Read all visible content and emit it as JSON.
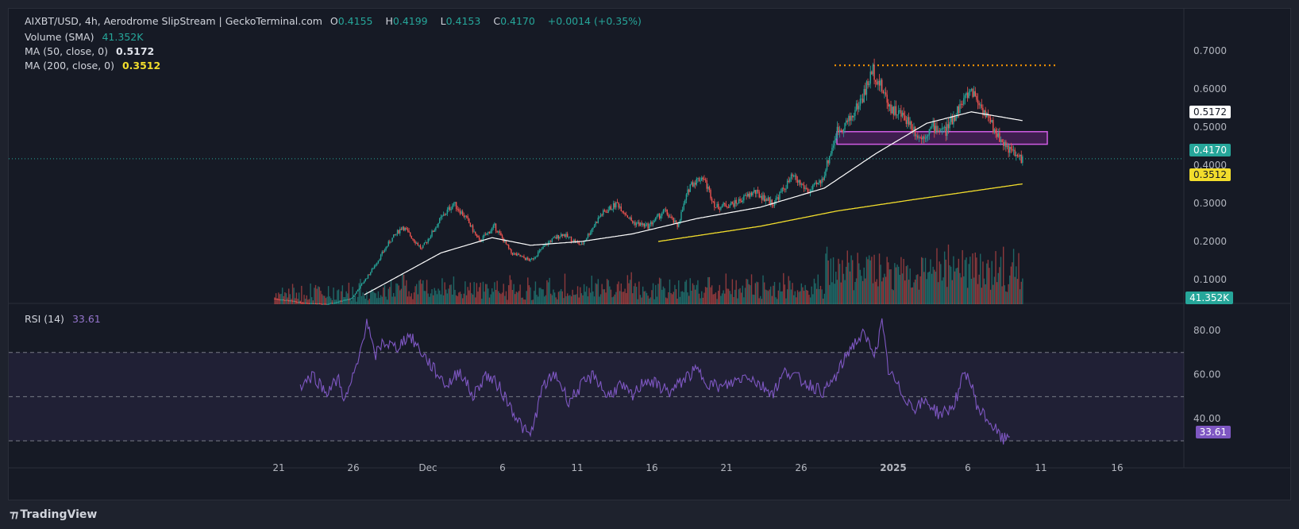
{
  "header": {
    "symbol_line": "AIXBT/USD, 4h, Aerodrome SlipStream | GeckoTerminal.com",
    "o_label": "O",
    "o_value": "0.4155",
    "h_label": "H",
    "h_value": "0.4199",
    "l_label": "L",
    "l_value": "0.4153",
    "c_label": "C",
    "c_value": "0.4170",
    "change": "+0.0014 (+0.35%)"
  },
  "indicators": {
    "volume_label": "Volume (SMA)",
    "volume_value": "41.352K",
    "ma50_label": "MA (50, close, 0)",
    "ma50_value": "0.5172",
    "ma200_label": "MA (200, close, 0)",
    "ma200_value": "0.3512",
    "rsi_label": "RSI (14)",
    "rsi_value": "33.61"
  },
  "badges": {
    "ma50": "0.5172",
    "price": "0.4170",
    "ma200": "0.3512",
    "volume": "41.352K",
    "rsi": "33.61"
  },
  "branding": {
    "logo_text": "TradingView"
  },
  "colors": {
    "up": "#26a69a",
    "down": "#ef5350",
    "ma50": "#ffffff",
    "ma200": "#f2dd2c",
    "rsi": "#7e57c2",
    "resistance": "#ff9800",
    "zone": "#9c27b0"
  },
  "chart_data": [
    {
      "type": "candlestick",
      "title": "AIXBT/USD 4h",
      "x_ticks": [
        "21",
        "26",
        "Dec",
        "6",
        "11",
        "16",
        "21",
        "26",
        "2025",
        "6",
        "11",
        "16"
      ],
      "y_ticks": [
        "0.7000",
        "0.6000",
        "0.5000",
        "0.4000",
        "0.3000",
        "0.2000",
        "0.1000"
      ],
      "ylim": [
        0.0,
        0.7
      ],
      "price_path": [
        [
          0,
          0.05
        ],
        [
          20,
          0.04
        ],
        [
          40,
          0.035
        ],
        [
          60,
          0.05
        ],
        [
          75,
          0.12
        ],
        [
          90,
          0.2
        ],
        [
          100,
          0.24
        ],
        [
          115,
          0.18
        ],
        [
          130,
          0.26
        ],
        [
          140,
          0.3
        ],
        [
          150,
          0.26
        ],
        [
          160,
          0.2
        ],
        [
          172,
          0.24
        ],
        [
          185,
          0.17
        ],
        [
          200,
          0.15
        ],
        [
          215,
          0.2
        ],
        [
          225,
          0.22
        ],
        [
          240,
          0.19
        ],
        [
          255,
          0.27
        ],
        [
          268,
          0.3
        ],
        [
          280,
          0.25
        ],
        [
          292,
          0.24
        ],
        [
          305,
          0.28
        ],
        [
          315,
          0.24
        ],
        [
          325,
          0.35
        ],
        [
          335,
          0.37
        ],
        [
          345,
          0.29
        ],
        [
          360,
          0.3
        ],
        [
          375,
          0.33
        ],
        [
          390,
          0.3
        ],
        [
          405,
          0.37
        ],
        [
          418,
          0.33
        ],
        [
          428,
          0.36
        ],
        [
          440,
          0.49
        ],
        [
          450,
          0.52
        ],
        [
          460,
          0.58
        ],
        [
          468,
          0.65
        ],
        [
          475,
          0.6
        ],
        [
          482,
          0.55
        ],
        [
          495,
          0.52
        ],
        [
          505,
          0.47
        ],
        [
          515,
          0.5
        ],
        [
          525,
          0.49
        ],
        [
          535,
          0.55
        ],
        [
          545,
          0.6
        ],
        [
          555,
          0.54
        ],
        [
          565,
          0.48
        ],
        [
          575,
          0.44
        ],
        [
          582,
          0.42
        ],
        [
          585,
          0.417
        ]
      ],
      "ma50": [
        [
          70,
          0.06
        ],
        [
          130,
          0.17
        ],
        [
          170,
          0.21
        ],
        [
          200,
          0.19
        ],
        [
          240,
          0.2
        ],
        [
          280,
          0.22
        ],
        [
          330,
          0.26
        ],
        [
          380,
          0.29
        ],
        [
          430,
          0.34
        ],
        [
          470,
          0.43
        ],
        [
          510,
          0.51
        ],
        [
          545,
          0.54
        ],
        [
          585,
          0.517
        ]
      ],
      "ma200": [
        [
          300,
          0.2
        ],
        [
          380,
          0.24
        ],
        [
          440,
          0.28
        ],
        [
          500,
          0.31
        ],
        [
          585,
          0.351
        ]
      ],
      "resistance": 0.662,
      "zone": [
        0.455,
        0.488
      ],
      "current_price": 0.417
    },
    {
      "type": "bar",
      "title": "Volume (SMA)",
      "last_value": "41.352K"
    },
    {
      "type": "line",
      "title": "RSI (14)",
      "y_ticks": [
        "80.00",
        "60.00",
        "40.00"
      ],
      "ylim": [
        25,
        90
      ],
      "bands": [
        30,
        50,
        70
      ],
      "path": [
        [
          20,
          55
        ],
        [
          30,
          60
        ],
        [
          40,
          52
        ],
        [
          50,
          58
        ],
        [
          55,
          48
        ],
        [
          65,
          65
        ],
        [
          72,
          85
        ],
        [
          78,
          68
        ],
        [
          85,
          75
        ],
        [
          95,
          72
        ],
        [
          105,
          78
        ],
        [
          115,
          70
        ],
        [
          125,
          62
        ],
        [
          135,
          55
        ],
        [
          145,
          62
        ],
        [
          155,
          50
        ],
        [
          165,
          60
        ],
        [
          175,
          55
        ],
        [
          185,
          45
        ],
        [
          195,
          35
        ],
        [
          200,
          32
        ],
        [
          210,
          55
        ],
        [
          220,
          60
        ],
        [
          230,
          48
        ],
        [
          240,
          55
        ],
        [
          250,
          60
        ],
        [
          260,
          50
        ],
        [
          270,
          55
        ],
        [
          280,
          50
        ],
        [
          290,
          58
        ],
        [
          300,
          55
        ],
        [
          310,
          52
        ],
        [
          320,
          58
        ],
        [
          330,
          62
        ],
        [
          340,
          56
        ],
        [
          350,
          54
        ],
        [
          360,
          57
        ],
        [
          370,
          60
        ],
        [
          380,
          55
        ],
        [
          390,
          52
        ],
        [
          400,
          62
        ],
        [
          410,
          58
        ],
        [
          420,
          55
        ],
        [
          430,
          52
        ],
        [
          440,
          60
        ],
        [
          450,
          72
        ],
        [
          460,
          78
        ],
        [
          470,
          70
        ],
        [
          475,
          83
        ],
        [
          480,
          62
        ],
        [
          490,
          52
        ],
        [
          500,
          45
        ],
        [
          510,
          48
        ],
        [
          520,
          42
        ],
        [
          530,
          45
        ],
        [
          535,
          52
        ],
        [
          540,
          62
        ],
        [
          545,
          55
        ],
        [
          550,
          45
        ],
        [
          560,
          38
        ],
        [
          570,
          30
        ],
        [
          575,
          33.61
        ]
      ]
    }
  ]
}
